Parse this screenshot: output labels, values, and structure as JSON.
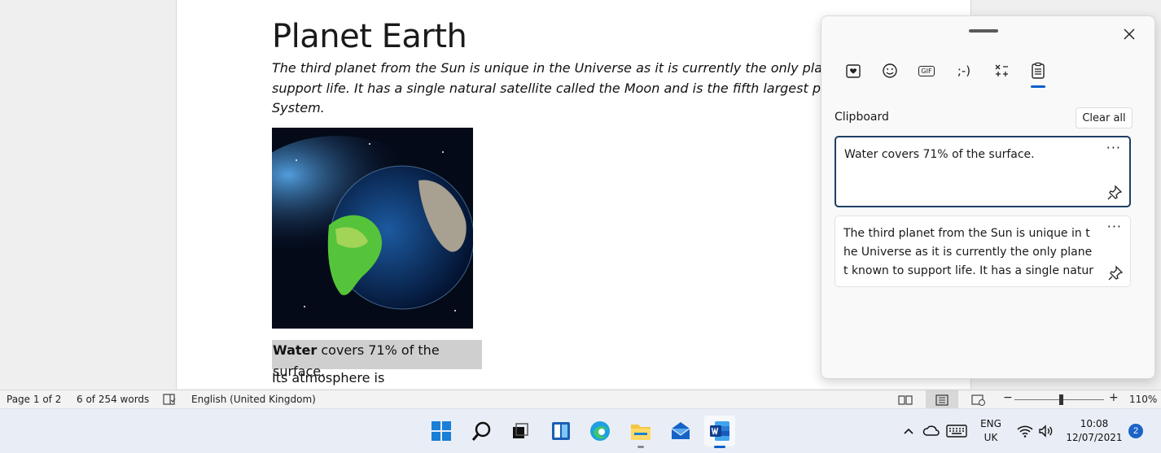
{
  "document": {
    "title": "Planet Earth",
    "intro_lines": [
      "The third planet from the Sun is unique in the Universe as it is currently the only planet known to",
      "support life. It has a single natural satellite called the Moon and is the fifth largest planet in the Solar",
      "System."
    ],
    "selected_bold": "Water",
    "selected_rest": " covers 71% of the surface.",
    "next_line": "Its atmosphere is"
  },
  "statusbar": {
    "page": "Page 1 of 2",
    "words": "6 of 254 words",
    "language": "English (United Kingdom)",
    "zoom": "110%",
    "zoom_minus": "−",
    "zoom_plus": "+"
  },
  "clipboard": {
    "heading": "Clipboard",
    "clear_all": "Clear all",
    "tabs": [
      "favorites-icon",
      "emoji-icon",
      "gif-icon",
      "kaomoji-icon",
      "symbols-icon",
      "clipboard-icon"
    ],
    "kaomoji_label": ";-)",
    "gif_label": "GIF",
    "items": [
      {
        "text": "Water covers 71% of the surface."
      },
      {
        "text": "The third planet from the Sun is unique in the Universe as it is currently the only planet known to support life. It has a single natural"
      }
    ],
    "more_label": "···"
  },
  "taskbar": {
    "language_line1": "ENG",
    "language_line2": "UK",
    "time": "10:08",
    "date": "12/07/2021",
    "notification_count": "2"
  },
  "colors": {
    "accent": "#0a5fc8",
    "selection": "#cfcfcf",
    "taskbar": "#e9eef6"
  }
}
